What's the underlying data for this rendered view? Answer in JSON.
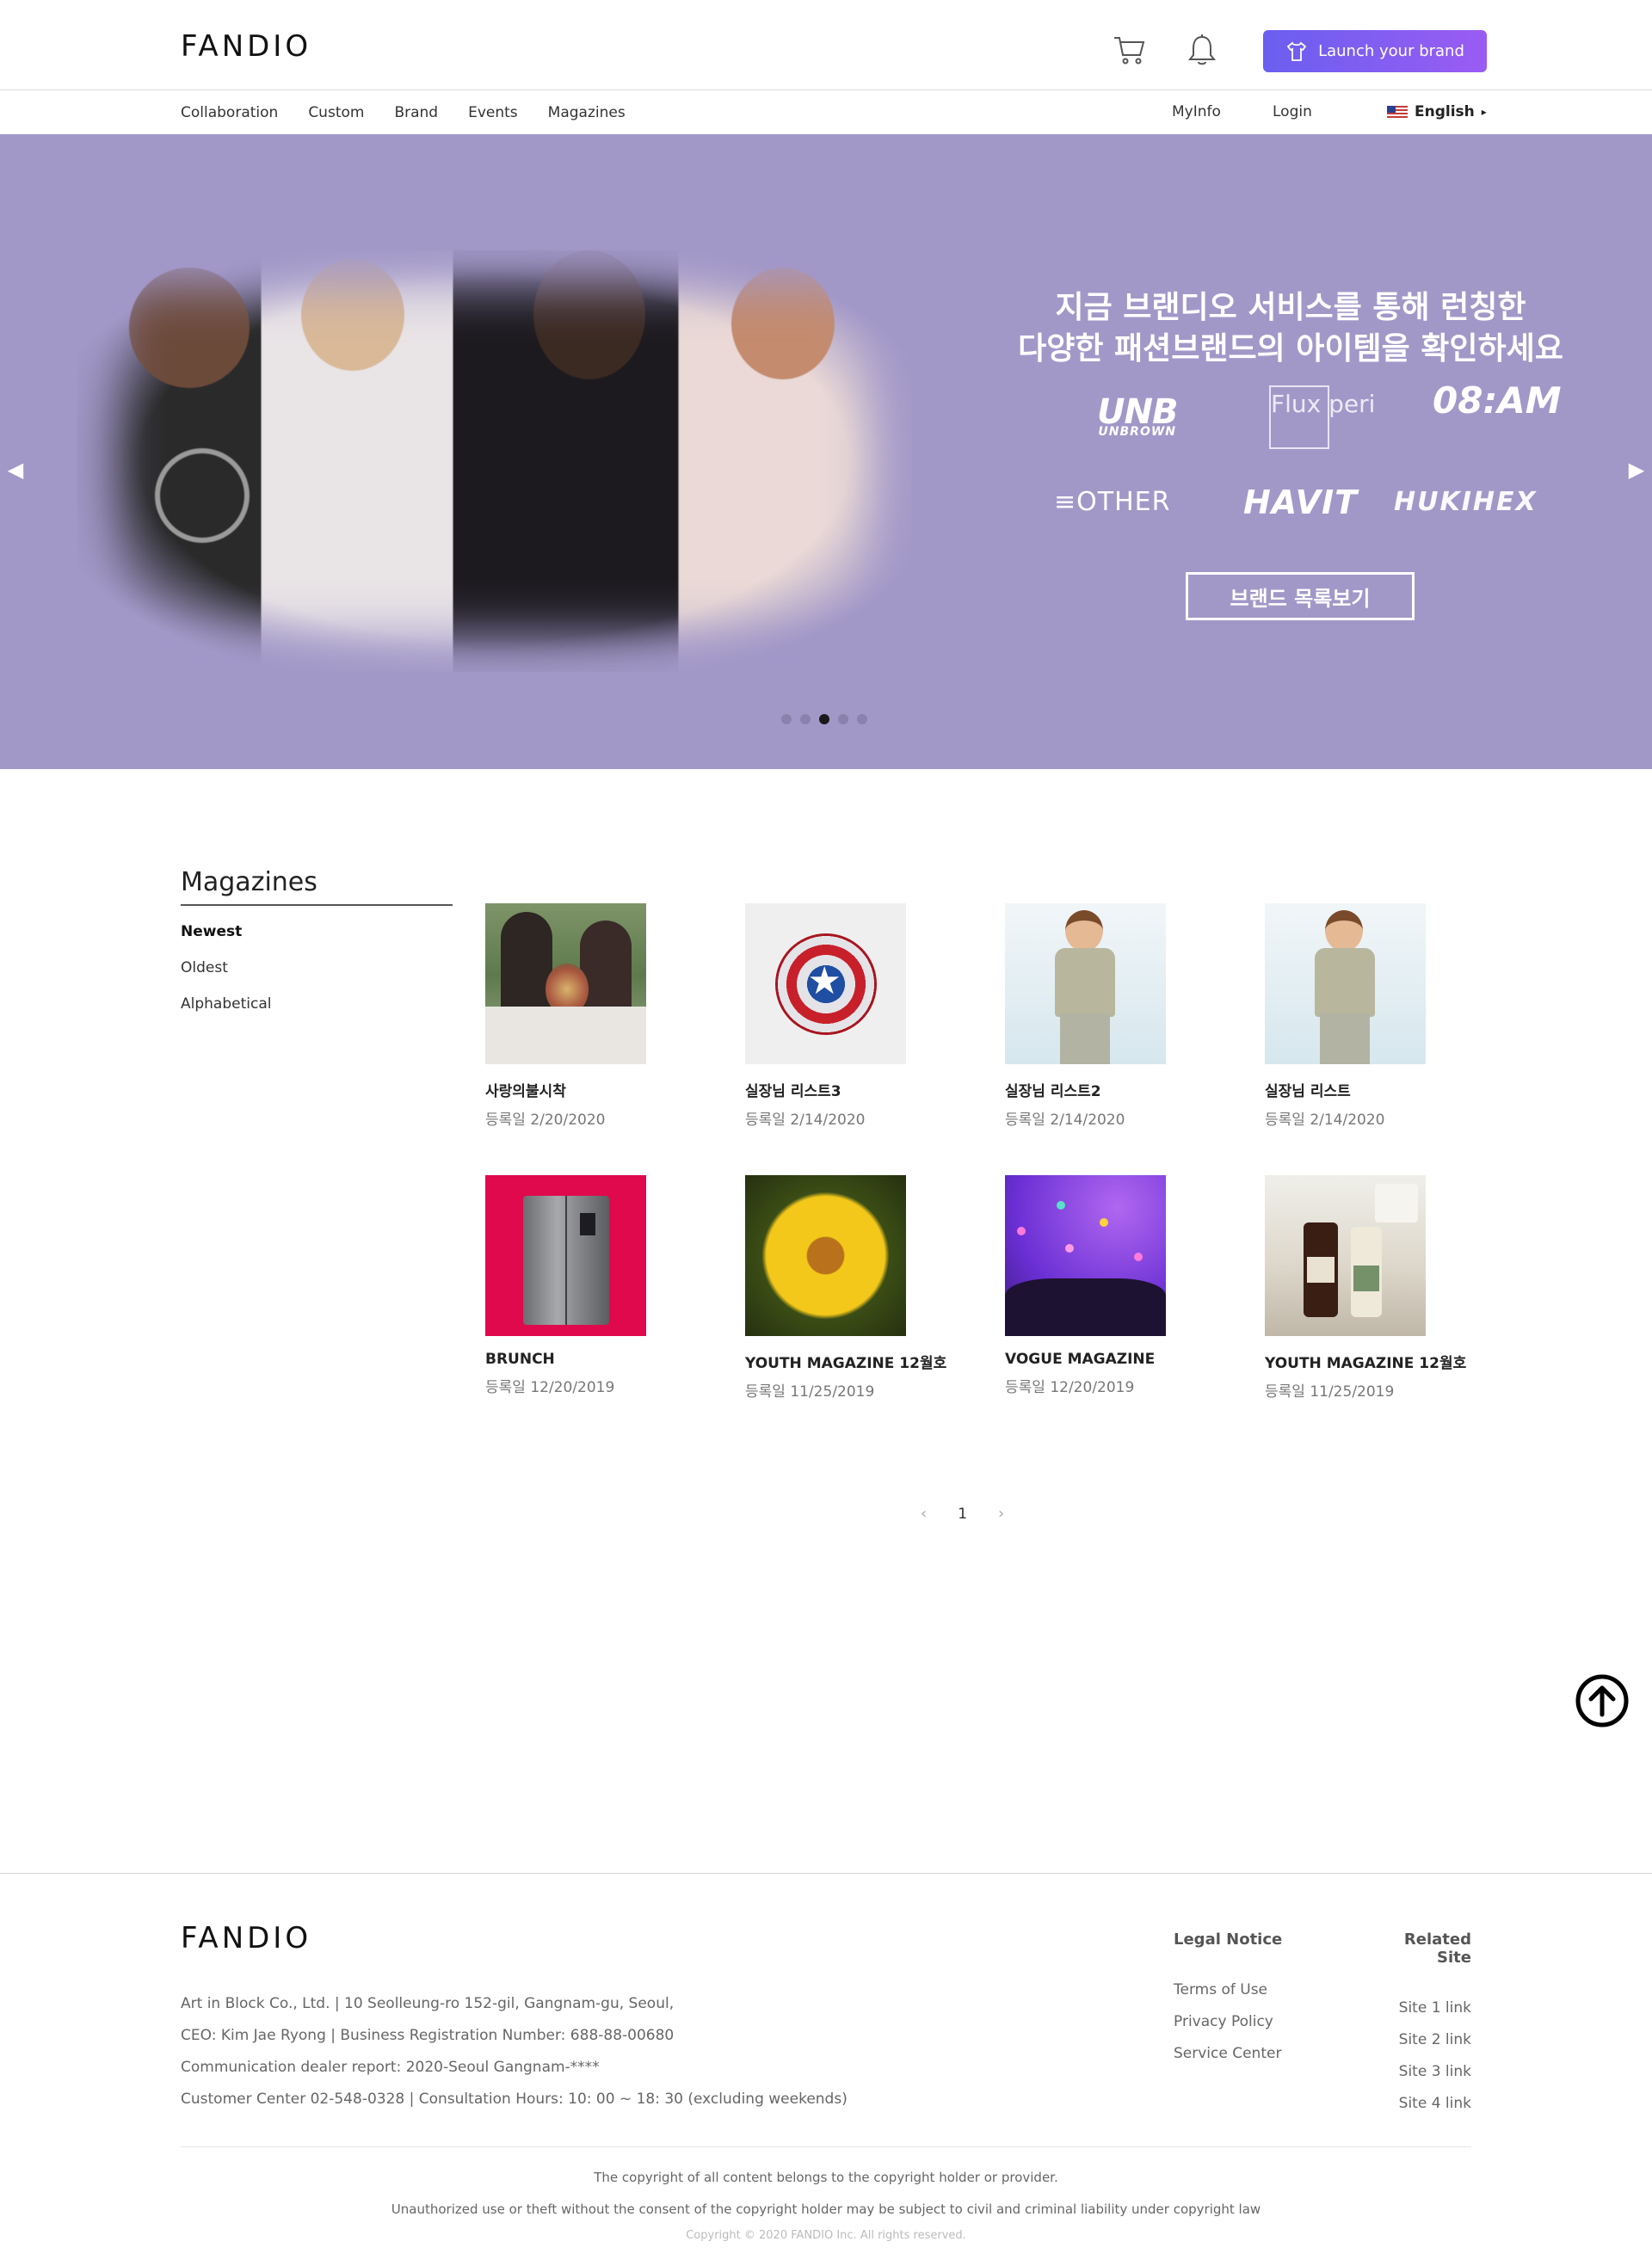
{
  "header": {
    "logo": "FANDIO",
    "launch_label": "Launch your brand",
    "icons": {
      "cart": "cart-icon",
      "bell": "bell-icon",
      "shirt": "shirt-icon"
    }
  },
  "nav": {
    "items": [
      "Collaboration",
      "Custom",
      "Brand",
      "Events",
      "Magazines"
    ],
    "myinfo": "MyInfo",
    "login": "Login",
    "language": "English"
  },
  "banner": {
    "heading_line1": "지금 브랜디오 서비스를 통해 런칭한",
    "heading_line2": "다양한 패션브랜드의 아이템을 확인하세요",
    "brands": [
      "UNB",
      "UNBROWN",
      "Flux peri",
      "08:AM",
      "≡OTHER",
      "HAVIT",
      "HUKIHEX"
    ],
    "button_label": "브랜드 목록보기",
    "active_slide": 3,
    "slide_count": 5,
    "background_color": "#a298c8"
  },
  "sidebar": {
    "title": "Magazines",
    "sort_options": [
      "Newest",
      "Oldest",
      "Alphabetical"
    ],
    "active_sort": "Newest"
  },
  "magazines": [
    {
      "title": "사랑의불시착",
      "date": "등록일 2/20/2020",
      "thumb": "couple"
    },
    {
      "title": "실장님 리스트3",
      "date": "등록일 2/14/2020",
      "thumb": "shield"
    },
    {
      "title": "실장님 리스트2",
      "date": "등록일 2/14/2020",
      "thumb": "boy"
    },
    {
      "title": "실장님 리스트",
      "date": "등록일 2/14/2020",
      "thumb": "boy"
    },
    {
      "title": "BRUNCH",
      "date": "등록일 12/20/2019",
      "thumb": "fridge"
    },
    {
      "title": "YOUTH MAGAZINE 12월호",
      "date": "등록일 11/25/2019",
      "thumb": "flower"
    },
    {
      "title": "VOGUE MAGAZINE",
      "date": "등록일 12/20/2019",
      "thumb": "concert"
    },
    {
      "title": "YOUTH MAGAZINE 12월호",
      "date": "등록일 11/25/2019",
      "thumb": "cosmetics"
    }
  ],
  "pagination": {
    "current": "1"
  },
  "footer": {
    "logo": "FANDIO",
    "info": [
      "Art in Block Co., Ltd. | 10 Seolleung-ro 152-gil, Gangnam-gu, Seoul,",
      "CEO: Kim Jae Ryong | Business Registration Number: 688-88-00680",
      "Communication dealer report: 2020-Seoul Gangnam-****",
      "Customer Center 02-548-0328 | Consultation Hours: 10: 00 ~ 18: 30 (excluding weekends)"
    ],
    "legal_title": "Legal Notice",
    "legal_links": [
      "Terms of Use",
      "Privacy Policy",
      "Service Center"
    ],
    "related_title": "Related Site",
    "related_links": [
      "Site 1 link",
      "Site 2 link",
      "Site 3 link",
      "Site 4 link"
    ],
    "notice1": "The copyright of all content belongs to the copyright holder or provider.",
    "notice2": "Unauthorized use or theft without the consent of the copyright holder may be subject to civil and criminal liability under copyright law",
    "copyright": "Copyright © 2020 FANDIO Inc. All rights reserved."
  },
  "colors": {
    "accent_start": "#6a5ff0",
    "accent_end": "#9a5cf3",
    "banner": "#a298c8"
  }
}
